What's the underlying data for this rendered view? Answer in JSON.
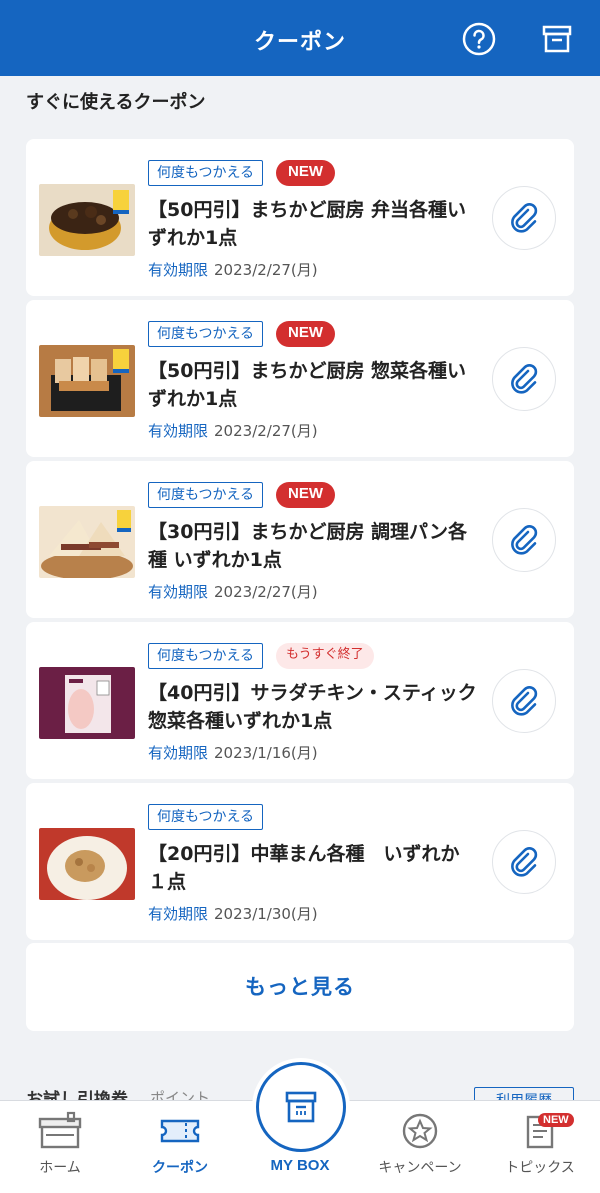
{
  "header": {
    "title": "クーポン",
    "help_icon": "question-circle-icon",
    "box_icon": "archive-box-icon"
  },
  "section": {
    "title": "すぐに使えるクーポン"
  },
  "coupons": [
    {
      "tag": "何度もつかえる",
      "badge": "NEW",
      "badge_type": "new",
      "title": "【50円引】まちかど厨房 弁当各種いずれか1点",
      "expiry_label": "有効期限",
      "expiry": "2023/2/27(月)",
      "image": "bento"
    },
    {
      "tag": "何度もつかえる",
      "badge": "NEW",
      "badge_type": "new",
      "title": "【50円引】まちかど厨房 惣菜各種いずれか1点",
      "expiry_label": "有効期限",
      "expiry": "2023/2/27(月)",
      "image": "katsu"
    },
    {
      "tag": "何度もつかえる",
      "badge": "NEW",
      "badge_type": "new",
      "title": "【30円引】まちかど厨房 調理パン各種 いずれか1点",
      "expiry_label": "有効期限",
      "expiry": "2023/2/27(月)",
      "image": "sandwich"
    },
    {
      "tag": "何度もつかえる",
      "badge": "もうすぐ終了",
      "badge_type": "ending",
      "title": "【40円引】サラダチキン・スティック惣菜各種いずれか1点",
      "expiry_label": "有効期限",
      "expiry": "2023/1/16(月)",
      "image": "chicken"
    },
    {
      "tag": "何度もつかえる",
      "badge": "",
      "badge_type": "none",
      "title": "【20円引】中華まん各種　いずれか１点",
      "expiry_label": "有効期限",
      "expiry": "2023/1/30(月)",
      "image": "bun"
    }
  ],
  "more_button": "もっと見る",
  "peek": {
    "left": "お試し引換券",
    "middle": "ポイント",
    "button": "利用履歴"
  },
  "tabbar": {
    "home": "ホーム",
    "coupon": "クーポン",
    "mybox": "MY BOX",
    "campaign": "キャンペーン",
    "topics": "トピックス",
    "topics_badge": "NEW"
  },
  "colors": {
    "brand": "#1565c0",
    "badge_new": "#d32f2f",
    "background": "#f0f2f5"
  }
}
